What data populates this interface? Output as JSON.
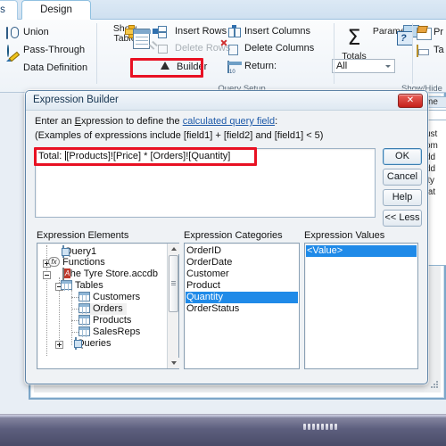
{
  "ribbon": {
    "tabs": [
      {
        "label": "s",
        "name": "tab-create-partial"
      },
      {
        "label": "Design",
        "name": "tab-design"
      }
    ],
    "groups": [
      {
        "label": "Query Setup",
        "name": "group-query-setup"
      },
      {
        "label": "Show/Hide",
        "name": "group-show-hide"
      }
    ],
    "query_type": [
      {
        "label": "Union",
        "icon": "union-icon",
        "disabled": false
      },
      {
        "label": "Pass-Through",
        "icon": "globe-icon",
        "disabled": false
      },
      {
        "label": "Data Definition",
        "icon": "pencil-icon",
        "disabled": false
      }
    ],
    "show_table": {
      "line1": "Show",
      "line2": "Table",
      "icon": "show-table-icon"
    },
    "rows_column": [
      {
        "label": "Insert Rows",
        "icon": "insert-rows-icon",
        "disabled": false
      },
      {
        "label": "Delete Rows",
        "icon": "delete-rows-icon",
        "disabled": true
      },
      {
        "label": "Builder",
        "icon": "builder-icon",
        "disabled": false
      }
    ],
    "columns_column": [
      {
        "label": "Insert Columns",
        "icon": "insert-columns-icon",
        "disabled": false
      },
      {
        "label": "Delete Columns",
        "icon": "delete-columns-icon",
        "disabled": false
      }
    ],
    "return": {
      "label": "Return:",
      "value": "All",
      "icon": "return-icon"
    },
    "totals": {
      "label": "Totals",
      "icon": "sigma-icon"
    },
    "parameters": {
      "label": "Parameters",
      "icon": "parameters-icon"
    },
    "show_hide": [
      {
        "label": "Pr",
        "icon": "property-sheet-icon"
      },
      {
        "label": "Ta",
        "icon": "table-names-icon"
      }
    ],
    "highlight_color": "#e81123"
  },
  "background": {
    "field_list_title": "me",
    "field_list_items": [
      "ust",
      "om",
      "dd",
      "dd",
      "ity",
      "tat"
    ]
  },
  "dialog": {
    "title": "Expression Builder",
    "close_label": "✕",
    "prompt_prefix": "Enter an ",
    "prompt_accel": "E",
    "prompt_mid": "xpression to define the ",
    "prompt_link": "calculated query field",
    "prompt_suffix": ":",
    "examples": "(Examples of expressions include [field1] + [field2] and [field1] < 5)",
    "expression_prefix": "Total: ",
    "expression_value": "[Products]![Price] * [Orders]![Quantity]",
    "buttons": [
      {
        "label": "OK",
        "name": "ok-button",
        "default": true
      },
      {
        "label": "Cancel",
        "name": "cancel-button",
        "default": false
      },
      {
        "label": "Help",
        "name": "help-button",
        "default": false
      },
      {
        "label": "<< Less",
        "name": "less-button",
        "default": false
      }
    ],
    "panes": {
      "elements": {
        "label": "Expression Elements",
        "tree": [
          {
            "label": "Query1",
            "depth": 1,
            "icon": "query-icon",
            "expander": "none",
            "selected": false
          },
          {
            "label": "Functions",
            "depth": 1,
            "icon": "function-icon",
            "expander": "plus",
            "selected": false
          },
          {
            "label": "The Tyre Store.accdb",
            "depth": 1,
            "icon": "database-icon",
            "expander": "minus",
            "selected": false
          },
          {
            "label": "Tables",
            "depth": 2,
            "icon": "table-icon",
            "expander": "minus",
            "selected": false
          },
          {
            "label": "Customers",
            "depth": 3,
            "icon": "table-icon",
            "expander": "none",
            "selected": false
          },
          {
            "label": "Orders",
            "depth": 3,
            "icon": "table-icon",
            "expander": "none",
            "selected": true
          },
          {
            "label": "Products",
            "depth": 3,
            "icon": "table-icon",
            "expander": "none",
            "selected": false
          },
          {
            "label": "SalesReps",
            "depth": 3,
            "icon": "table-icon",
            "expander": "none",
            "selected": false
          },
          {
            "label": "Queries",
            "depth": 2,
            "icon": "query-icon",
            "expander": "plus",
            "selected": false
          }
        ]
      },
      "categories": {
        "label": "Expression Categories",
        "items": [
          {
            "label": "OrderID",
            "selected": false
          },
          {
            "label": "OrderDate",
            "selected": false
          },
          {
            "label": "Customer",
            "selected": false
          },
          {
            "label": "Product",
            "selected": false
          },
          {
            "label": "Quantity",
            "selected": true
          },
          {
            "label": "OrderStatus",
            "selected": false
          }
        ]
      },
      "values": {
        "label": "Expression Values",
        "items": [
          {
            "label": "<Value>",
            "selected": true
          }
        ]
      }
    },
    "selection_color": "#1f8ae8"
  }
}
